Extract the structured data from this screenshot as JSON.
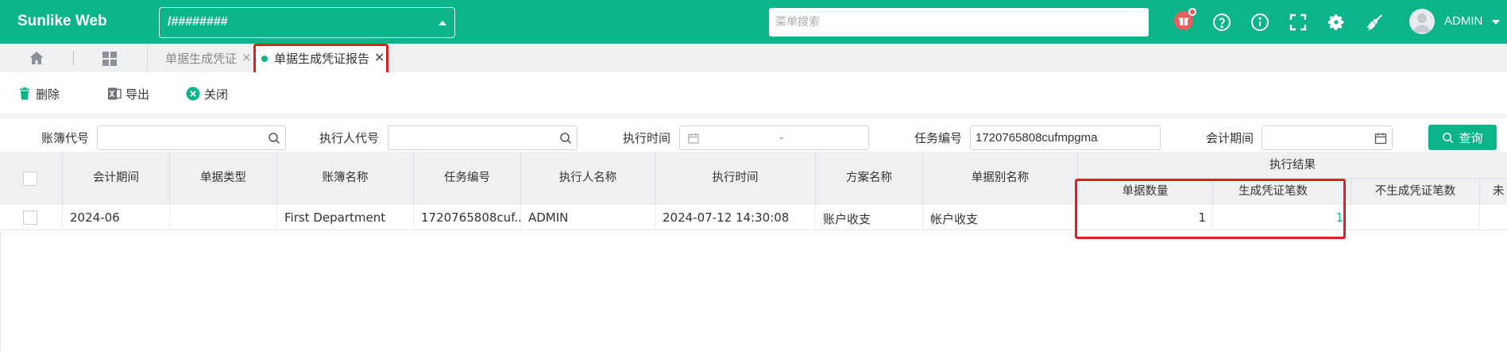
{
  "app": {
    "title": "Sunlike Web"
  },
  "header": {
    "path_value": "/########",
    "menu_search_placeholder": "菜单搜索",
    "user_name": "ADMIN"
  },
  "tabs": [
    {
      "label": "单据生成凭证",
      "close": "×"
    },
    {
      "label": "单据生成凭证报告",
      "close": "×"
    }
  ],
  "toolbar": {
    "delete_label": "删除",
    "export_label": "导出",
    "close_label": "关闭"
  },
  "filters": {
    "book_code_label": "账簿代号",
    "executor_code_label": "执行人代号",
    "exec_time_label": "执行时间",
    "exec_time_separator": "-",
    "task_no_label": "任务编号",
    "task_no_value": "1720765808cufmpgma",
    "period_label": "会计期间",
    "query_label": "查询"
  },
  "table": {
    "columns": {
      "period": "会计期间",
      "doc_type": "单据类型",
      "book_name": "账簿名称",
      "task_no": "任务编号",
      "executor_name": "执行人名称",
      "exec_time": "执行时间",
      "scheme_name": "方案名称",
      "doc_alias": "单据别名称",
      "result_group": "执行结果",
      "doc_count": "单据数量",
      "voucher_count": "生成凭证笔数",
      "no_voucher_count": "不生成凭证笔数",
      "partial_header": "未"
    },
    "rows": [
      {
        "period": "2024-06",
        "doc_type": "",
        "book_name": "First Department",
        "task_no": "1720765808cuf...",
        "executor_name": "ADMIN",
        "exec_time": "2024-07-12 14:30:08",
        "scheme_name": "账户收支",
        "doc_alias": "帐户收支",
        "doc_count": "1",
        "voucher_count": "1",
        "no_voucher_count": ""
      }
    ]
  },
  "colors": {
    "brand": "#0cb48a",
    "highlight": "#e02020",
    "link_green": "#0cb48a"
  }
}
